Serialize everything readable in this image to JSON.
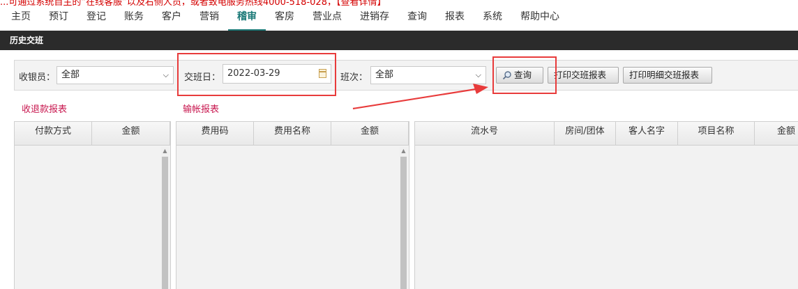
{
  "banner_text": "...可通过系统自主的“在线客服”以及右侧人员，或者致电服务热线4000-518-028，【查看详情】",
  "nav": {
    "items": [
      "主页",
      "预订",
      "登记",
      "账务",
      "客户",
      "营销",
      "稽审",
      "客房",
      "营业点",
      "进销存",
      "查询",
      "报表",
      "系统",
      "帮助中心"
    ],
    "active_index": 6
  },
  "page_title": "历史交班",
  "filters": {
    "cashier_label": "收银员：",
    "cashier_value": "全部",
    "date_label": "交班日：",
    "date_value": "2022-03-29",
    "shift_label": "班次：",
    "shift_value": "全部"
  },
  "buttons": {
    "query": "查询",
    "print_shift": "打印交班报表",
    "print_detail": "打印明细交班报表"
  },
  "links": {
    "refund_report": "收退款报表",
    "ledger_report": "输帐报表"
  },
  "grid1": {
    "columns": [
      "付款方式",
      "金额"
    ]
  },
  "grid2": {
    "columns": [
      "费用码",
      "费用名称",
      "金额"
    ]
  },
  "grid3": {
    "columns": [
      "流水号",
      "房间/团体",
      "客人名字",
      "项目名称",
      "金额"
    ]
  },
  "colors": {
    "accent": "#1c7a78",
    "title_bar": "#2b2b2b",
    "annotation_red": "#e83b3b",
    "link": "#c8174f"
  }
}
